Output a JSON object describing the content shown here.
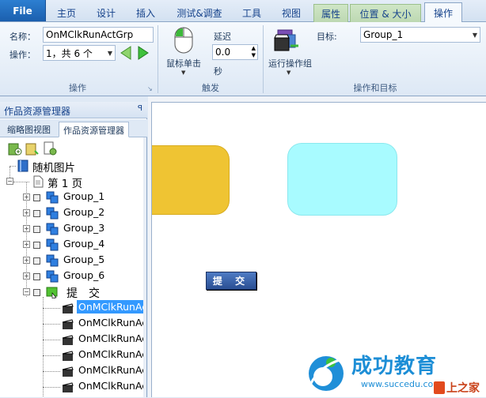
{
  "tabs": {
    "file": "File",
    "items": [
      "主页",
      "设计",
      "插入",
      "测试&调查",
      "工具",
      "视图",
      "属性",
      "位置 & 大小",
      "操作"
    ],
    "active": "操作"
  },
  "ribbon": {
    "action": {
      "name_label": "名称：",
      "name_value": "OnMClkRunActGrp",
      "op_label": "操作：",
      "op_value": "1，共 6 个",
      "group_label": "操作"
    },
    "trigger": {
      "mouse_label": "鼠标单击",
      "delay_label": "延迟",
      "delay_value": "0.0",
      "unit_label": "秒",
      "group_label": "触发"
    },
    "target": {
      "run_label": "运行操作组",
      "target_label": "目标:",
      "target_value": "Group_1",
      "group_label": "操作和目标"
    }
  },
  "panel": {
    "title": "作品资源管理器",
    "pin_icon": "pin-icon",
    "tabs": [
      "缩略图视图",
      "作品资源管理器"
    ],
    "tree": {
      "root": "随机图片",
      "page": "第 1 页",
      "groups": [
        "Group_1",
        "Group_2",
        "Group_3",
        "Group_4",
        "Group_5",
        "Group_6"
      ],
      "submit": "提　交",
      "actions": [
        "OnMClkRunAc",
        "OnMClkRunAc",
        "OnMClkRunAc",
        "OnMClkRunAc",
        "OnMClkRunAc",
        "OnMClkRunAc"
      ]
    }
  },
  "canvas": {
    "submit_button": "提 交",
    "watermark_title": "成功教育",
    "watermark_url": "www.succedu.com",
    "watermark_corner": "上之家",
    "colors": {
      "yellow": "#efc433",
      "cyan": "#a8fbff",
      "accent": "#1b5fae"
    }
  }
}
